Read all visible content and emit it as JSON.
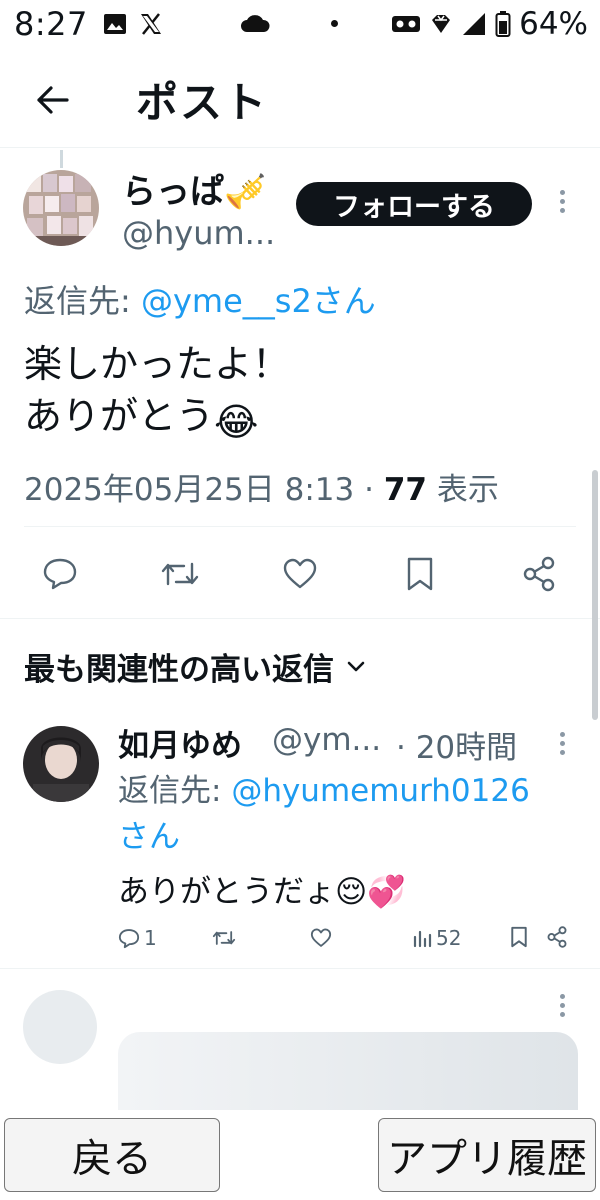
{
  "status_bar": {
    "time": "8:27",
    "battery": "64%",
    "icons": [
      "image-icon",
      "x-logo-icon",
      "cloud-icon",
      "dot-icon",
      "vr-icon",
      "diamond-icon",
      "signal-icon",
      "battery-icon"
    ]
  },
  "header": {
    "title": "ポスト",
    "back_icon": "back-arrow-icon"
  },
  "post": {
    "author_name": "らっぱ🎺",
    "author_handle": "@hyum...",
    "follow_label": "フォローする",
    "reply_to_prefix": "返信先: ",
    "reply_to_mention": "@yme__s2さん",
    "text_line1": "楽しかったよ！",
    "text_line2": "ありがとう",
    "text_emoji": "😂",
    "date": "2025年05月25日 8:13 · ",
    "views_count": "77",
    "views_label": " 表示"
  },
  "actions": [
    "reply-icon",
    "retweet-icon",
    "like-icon",
    "bookmark-icon",
    "share-icon"
  ],
  "replies_section": {
    "title": "最も関連性の高い返信"
  },
  "reply": {
    "name": "如月ゆめ",
    "handle": "@ym...",
    "time": "· 20時間",
    "reply_to_prefix": "返信先: ",
    "reply_to_mention": "@hyumemurh0126",
    "reply_to_suffix": "さん",
    "text": "ありがとうだょ😌💞",
    "reply_count": "1",
    "views": "52"
  },
  "bottom_nav": {
    "back_label": "戻る",
    "apps_label": "アプリ履歴"
  },
  "colors": {
    "accent": "#1d9bf0",
    "text": "#0f1419",
    "secondary": "#536471"
  }
}
